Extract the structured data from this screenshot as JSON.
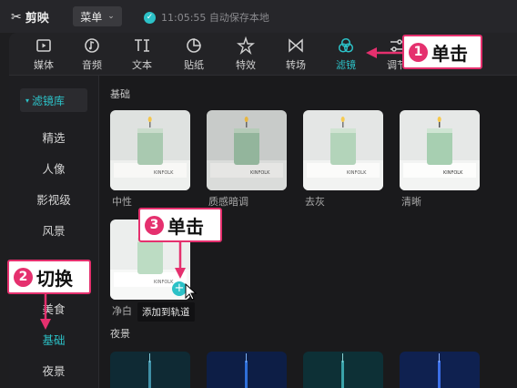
{
  "app": {
    "logo_text": "剪映",
    "menu_label": "菜单",
    "save_status": "11:05:55 自动保存本地"
  },
  "toolbar": {
    "items": [
      {
        "label": "媒体",
        "icon": "media-icon"
      },
      {
        "label": "音频",
        "icon": "audio-icon"
      },
      {
        "label": "文本",
        "icon": "text-icon"
      },
      {
        "label": "贴纸",
        "icon": "sticker-icon"
      },
      {
        "label": "特效",
        "icon": "effects-icon"
      },
      {
        "label": "转场",
        "icon": "transition-icon"
      },
      {
        "label": "滤镜",
        "icon": "filter-icon",
        "active": true
      },
      {
        "label": "调节",
        "icon": "adjust-icon"
      }
    ]
  },
  "sidebar": {
    "header": "滤镜库",
    "items": [
      "精选",
      "人像",
      "影视级",
      "风景",
      "美食",
      "基础",
      "夜景"
    ],
    "active": "基础"
  },
  "content": {
    "section_basic": "基础",
    "basic_filters": [
      "中性",
      "质感暗调",
      "去灰",
      "清晰",
      "净白"
    ],
    "section_night": "夜景",
    "add_tooltip": "添加到轨道"
  },
  "annotations": {
    "step1": {
      "num": "1",
      "text": "单击"
    },
    "step2": {
      "num": "2",
      "text": "切换"
    },
    "step3": {
      "num": "3",
      "text": "单击"
    }
  },
  "colors": {
    "accent": "#2cc1c7",
    "callout": "#e5306e"
  }
}
